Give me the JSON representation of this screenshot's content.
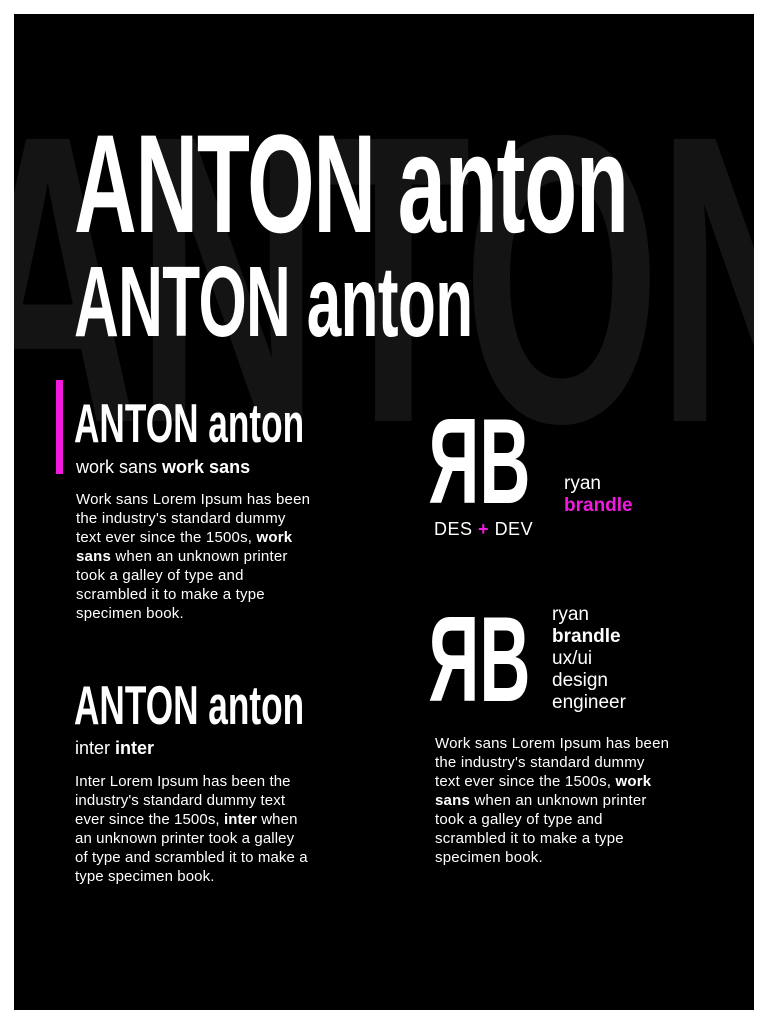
{
  "background_word": "ANTON",
  "titles": {
    "hero_line_1": "ANTON anton",
    "hero_line_2": "ANTON anton",
    "section_1": "ANTON anton",
    "section_2": "ANTON anton"
  },
  "work_sans_block": {
    "label_regular": "work sans",
    "label_bold": "work sans",
    "text_before": "Work sans Lorem Ipsum has been the industry's standard dummy text ever since the 1500s, ",
    "text_bold": "work sans",
    "text_after": " when an unknown printer took a galley of type and scrambled it to make a type specimen book."
  },
  "inter_block": {
    "label_regular": "inter",
    "label_bold": "inter",
    "text_before": "Inter Lorem Ipsum has been the industry's standard dummy text ever since the 1500s, ",
    "text_bold": "inter",
    "text_after": " when an unknown printer took a galley of type and scrambled it to make a type specimen book."
  },
  "logo_1": {
    "letter_r": "R",
    "letter_b": "B",
    "tagline_left": "DES",
    "tagline_plus": "+",
    "tagline_right": "DEV",
    "first_name": "ryan",
    "last_name": "brandle"
  },
  "logo_2": {
    "letter_r": "R",
    "letter_b": "B",
    "lines": [
      "ryan",
      "brandle",
      "ux/ui",
      "design",
      "engineer"
    ]
  },
  "right_text": {
    "text_before": "Work sans Lorem Ipsum has been the industry's standard dummy text ever since the 1500s, ",
    "text_bold": "work sans",
    "text_after": " when an unknown printer took a galley of type and scrambled it to make a type specimen book."
  },
  "colors": {
    "background": "#000000",
    "text": "#ffffff",
    "accent": "#f31ae0",
    "watermark": "#141414"
  }
}
